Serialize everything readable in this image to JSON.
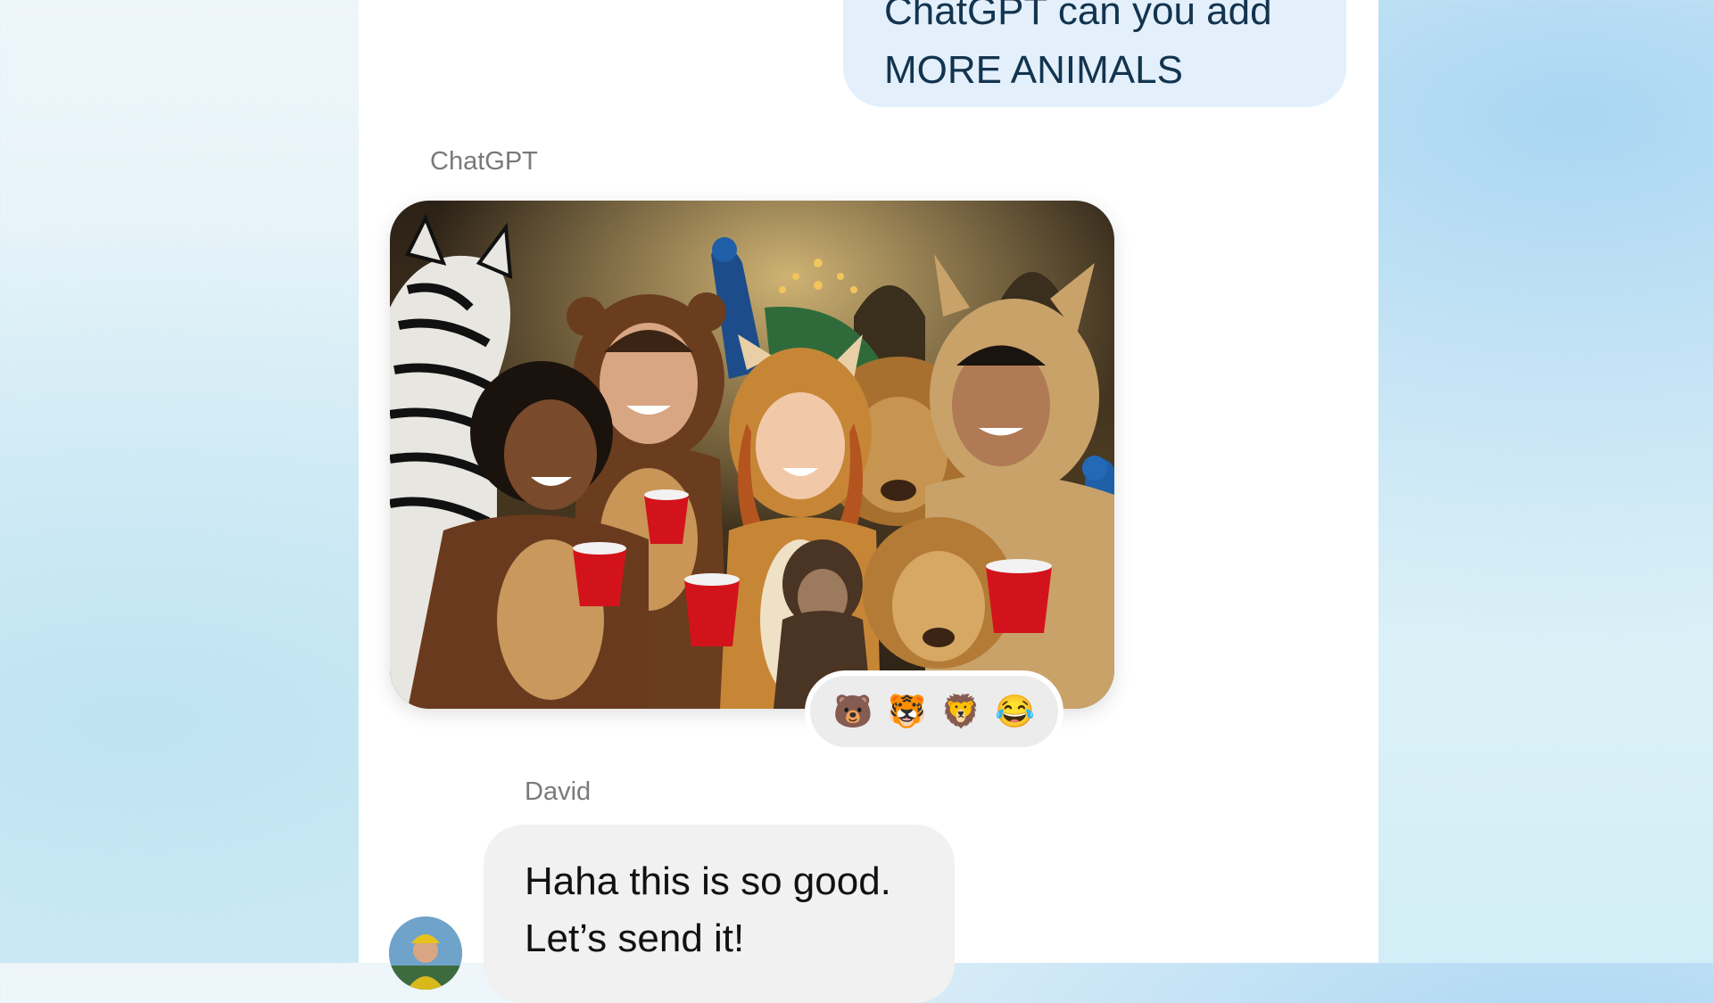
{
  "conversation": {
    "user_message": "ChatGPT can you add\nMORE ANIMALS",
    "assistant_name": "ChatGPT",
    "reactions": [
      "🐻",
      "🐯",
      "🦁",
      "😂"
    ],
    "reply_sender": "David",
    "reply_message": "Haha this is so good.\nLet’s send it!"
  }
}
